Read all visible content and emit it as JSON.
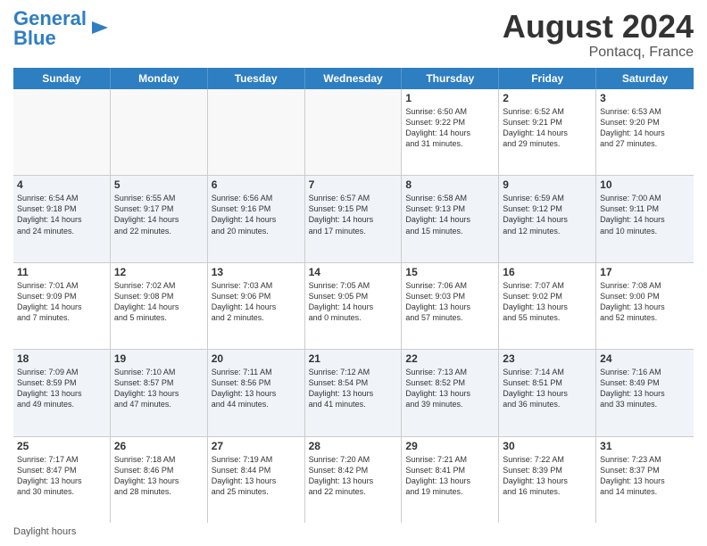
{
  "header": {
    "logo_line1": "General",
    "logo_line2": "Blue",
    "month_year": "August 2024",
    "location": "Pontacq, France"
  },
  "days_of_week": [
    "Sunday",
    "Monday",
    "Tuesday",
    "Wednesday",
    "Thursday",
    "Friday",
    "Saturday"
  ],
  "footer": {
    "daylight_label": "Daylight hours"
  },
  "weeks": [
    {
      "alt": false,
      "cells": [
        {
          "day": "",
          "content": ""
        },
        {
          "day": "",
          "content": ""
        },
        {
          "day": "",
          "content": ""
        },
        {
          "day": "",
          "content": ""
        },
        {
          "day": "1",
          "content": "Sunrise: 6:50 AM\nSunset: 9:22 PM\nDaylight: 14 hours\nand 31 minutes."
        },
        {
          "day": "2",
          "content": "Sunrise: 6:52 AM\nSunset: 9:21 PM\nDaylight: 14 hours\nand 29 minutes."
        },
        {
          "day": "3",
          "content": "Sunrise: 6:53 AM\nSunset: 9:20 PM\nDaylight: 14 hours\nand 27 minutes."
        }
      ]
    },
    {
      "alt": true,
      "cells": [
        {
          "day": "4",
          "content": "Sunrise: 6:54 AM\nSunset: 9:18 PM\nDaylight: 14 hours\nand 24 minutes."
        },
        {
          "day": "5",
          "content": "Sunrise: 6:55 AM\nSunset: 9:17 PM\nDaylight: 14 hours\nand 22 minutes."
        },
        {
          "day": "6",
          "content": "Sunrise: 6:56 AM\nSunset: 9:16 PM\nDaylight: 14 hours\nand 20 minutes."
        },
        {
          "day": "7",
          "content": "Sunrise: 6:57 AM\nSunset: 9:15 PM\nDaylight: 14 hours\nand 17 minutes."
        },
        {
          "day": "8",
          "content": "Sunrise: 6:58 AM\nSunset: 9:13 PM\nDaylight: 14 hours\nand 15 minutes."
        },
        {
          "day": "9",
          "content": "Sunrise: 6:59 AM\nSunset: 9:12 PM\nDaylight: 14 hours\nand 12 minutes."
        },
        {
          "day": "10",
          "content": "Sunrise: 7:00 AM\nSunset: 9:11 PM\nDaylight: 14 hours\nand 10 minutes."
        }
      ]
    },
    {
      "alt": false,
      "cells": [
        {
          "day": "11",
          "content": "Sunrise: 7:01 AM\nSunset: 9:09 PM\nDaylight: 14 hours\nand 7 minutes."
        },
        {
          "day": "12",
          "content": "Sunrise: 7:02 AM\nSunset: 9:08 PM\nDaylight: 14 hours\nand 5 minutes."
        },
        {
          "day": "13",
          "content": "Sunrise: 7:03 AM\nSunset: 9:06 PM\nDaylight: 14 hours\nand 2 minutes."
        },
        {
          "day": "14",
          "content": "Sunrise: 7:05 AM\nSunset: 9:05 PM\nDaylight: 14 hours\nand 0 minutes."
        },
        {
          "day": "15",
          "content": "Sunrise: 7:06 AM\nSunset: 9:03 PM\nDaylight: 13 hours\nand 57 minutes."
        },
        {
          "day": "16",
          "content": "Sunrise: 7:07 AM\nSunset: 9:02 PM\nDaylight: 13 hours\nand 55 minutes."
        },
        {
          "day": "17",
          "content": "Sunrise: 7:08 AM\nSunset: 9:00 PM\nDaylight: 13 hours\nand 52 minutes."
        }
      ]
    },
    {
      "alt": true,
      "cells": [
        {
          "day": "18",
          "content": "Sunrise: 7:09 AM\nSunset: 8:59 PM\nDaylight: 13 hours\nand 49 minutes."
        },
        {
          "day": "19",
          "content": "Sunrise: 7:10 AM\nSunset: 8:57 PM\nDaylight: 13 hours\nand 47 minutes."
        },
        {
          "day": "20",
          "content": "Sunrise: 7:11 AM\nSunset: 8:56 PM\nDaylight: 13 hours\nand 44 minutes."
        },
        {
          "day": "21",
          "content": "Sunrise: 7:12 AM\nSunset: 8:54 PM\nDaylight: 13 hours\nand 41 minutes."
        },
        {
          "day": "22",
          "content": "Sunrise: 7:13 AM\nSunset: 8:52 PM\nDaylight: 13 hours\nand 39 minutes."
        },
        {
          "day": "23",
          "content": "Sunrise: 7:14 AM\nSunset: 8:51 PM\nDaylight: 13 hours\nand 36 minutes."
        },
        {
          "day": "24",
          "content": "Sunrise: 7:16 AM\nSunset: 8:49 PM\nDaylight: 13 hours\nand 33 minutes."
        }
      ]
    },
    {
      "alt": false,
      "cells": [
        {
          "day": "25",
          "content": "Sunrise: 7:17 AM\nSunset: 8:47 PM\nDaylight: 13 hours\nand 30 minutes."
        },
        {
          "day": "26",
          "content": "Sunrise: 7:18 AM\nSunset: 8:46 PM\nDaylight: 13 hours\nand 28 minutes."
        },
        {
          "day": "27",
          "content": "Sunrise: 7:19 AM\nSunset: 8:44 PM\nDaylight: 13 hours\nand 25 minutes."
        },
        {
          "day": "28",
          "content": "Sunrise: 7:20 AM\nSunset: 8:42 PM\nDaylight: 13 hours\nand 22 minutes."
        },
        {
          "day": "29",
          "content": "Sunrise: 7:21 AM\nSunset: 8:41 PM\nDaylight: 13 hours\nand 19 minutes."
        },
        {
          "day": "30",
          "content": "Sunrise: 7:22 AM\nSunset: 8:39 PM\nDaylight: 13 hours\nand 16 minutes."
        },
        {
          "day": "31",
          "content": "Sunrise: 7:23 AM\nSunset: 8:37 PM\nDaylight: 13 hours\nand 14 minutes."
        }
      ]
    }
  ]
}
